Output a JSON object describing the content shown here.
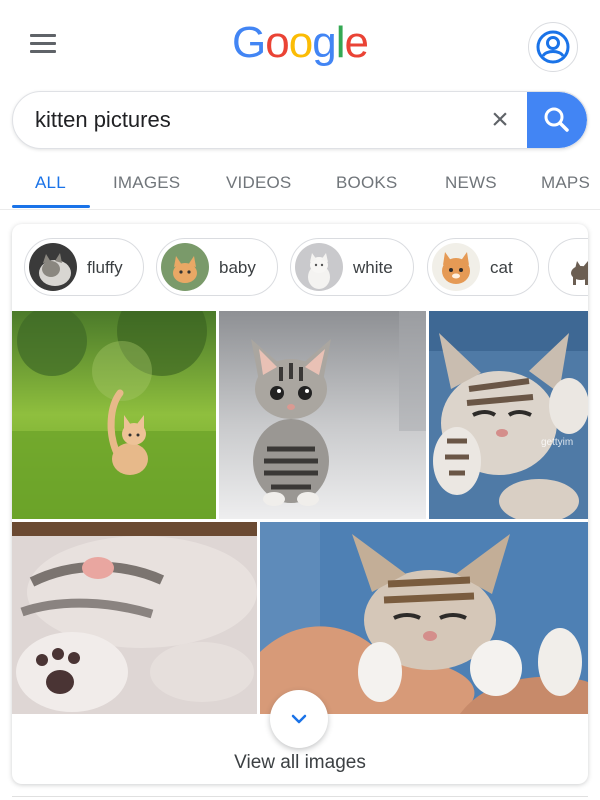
{
  "header": {
    "logo_letters": [
      "G",
      "o",
      "o",
      "g",
      "l",
      "e"
    ],
    "menu_icon": "hamburger-menu-icon",
    "account_icon": "account-circle-icon"
  },
  "search": {
    "query": "kitten pictures",
    "clear_icon": "close-icon",
    "clear_label": "×",
    "submit_icon": "search-icon"
  },
  "tabs": [
    {
      "label": "ALL",
      "active": true
    },
    {
      "label": "IMAGES"
    },
    {
      "label": "VIDEOS"
    },
    {
      "label": "BOOKS"
    },
    {
      "label": "NEWS"
    },
    {
      "label": "MAPS"
    }
  ],
  "chips": [
    {
      "label": "fluffy"
    },
    {
      "label": "baby"
    },
    {
      "label": "white"
    },
    {
      "label": "cat"
    },
    {
      "label": ""
    }
  ],
  "images": {
    "watermark": "gettyim"
  },
  "view_all": {
    "label": "View all images",
    "expand_icon": "chevron-down-icon"
  },
  "colors": {
    "accent": "#1a73e8",
    "search_button": "#4285f4",
    "logo_blue": "#4285f4",
    "logo_red": "#ea4335",
    "logo_yellow": "#fbbc05",
    "logo_green": "#34a853"
  }
}
